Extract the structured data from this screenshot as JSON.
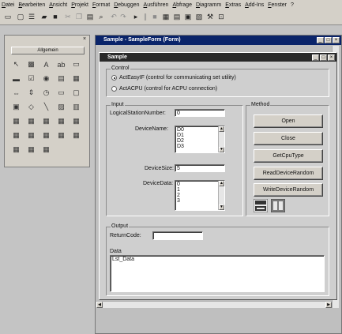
{
  "menu": [
    "Datei",
    "Bearbeiten",
    "Ansicht",
    "Projekt",
    "Format",
    "Debuggen",
    "Ausführen",
    "Abfrage",
    "Diagramm",
    "Extras",
    "Add-Ins",
    "Fenster",
    "?"
  ],
  "toolbar_icons": [
    "add-project-icon",
    "add-form-icon",
    "menu-editor-icon",
    "open-icon",
    "save-icon",
    "cut-icon",
    "copy-icon",
    "paste-icon",
    "find-icon",
    "undo-icon",
    "redo-icon",
    "run-icon",
    "pause-icon",
    "stop-icon",
    "project-explorer-icon",
    "properties-icon",
    "form-layout-icon",
    "object-browser-icon",
    "toolbox-icon",
    "data-view-icon"
  ],
  "toolbox": {
    "tab_label": "Allgemein",
    "close_glyph": "×",
    "tools": [
      "pointer-icon",
      "picturebox-icon",
      "label-icon",
      "textbox-icon",
      "frame-icon",
      "commandbutton-icon",
      "checkbox-icon",
      "optionbutton-icon",
      "combobox-icon",
      "listbox-icon",
      "hscrollbar-icon",
      "vscrollbar-icon",
      "timer-icon",
      "drivelist-icon",
      "dirlist-icon",
      "filelist-icon",
      "shape-icon",
      "line-icon",
      "image-icon",
      "data-icon",
      "ole-icon",
      "actx-control-icon",
      "actx-control-icon",
      "actx-control-icon",
      "actx-control-icon",
      "actx-control-icon",
      "actx-control-icon",
      "actx-control-icon",
      "actx-control-icon",
      "actx-control-icon",
      "actx-control-icon",
      "actx-control-icon",
      "actx-control-icon"
    ]
  },
  "mdi": {
    "title": "Sample - SampleForm (Form)"
  },
  "form": {
    "title": "Sample",
    "control": {
      "title": "Control",
      "option1": "ActEasyIF (control for communicating set utility)",
      "option2": "ActACPU (control for ACPU connection)"
    },
    "input": {
      "title": "Input",
      "station_label": "LogicalStationNumber:",
      "station_value": "0",
      "device_name_label": "DeviceName:",
      "device_names": [
        "D0",
        "D1",
        "D2",
        "D3"
      ],
      "device_size_label": "DeviceSize:",
      "device_size_value": "5",
      "device_data_label": "DeviceData:",
      "device_data": [
        "0",
        "1",
        "2",
        "3"
      ]
    },
    "method": {
      "title": "Method",
      "buttons": [
        "Open",
        "Close",
        "GetCpuType",
        "ReadDeviceRandom",
        "WriteDeviceRandom"
      ]
    },
    "output": {
      "title": "Output",
      "return_code_label": "ReturnCode:",
      "return_code_value": ""
    },
    "data": {
      "label": "Data",
      "value": "Lst_Data"
    }
  }
}
